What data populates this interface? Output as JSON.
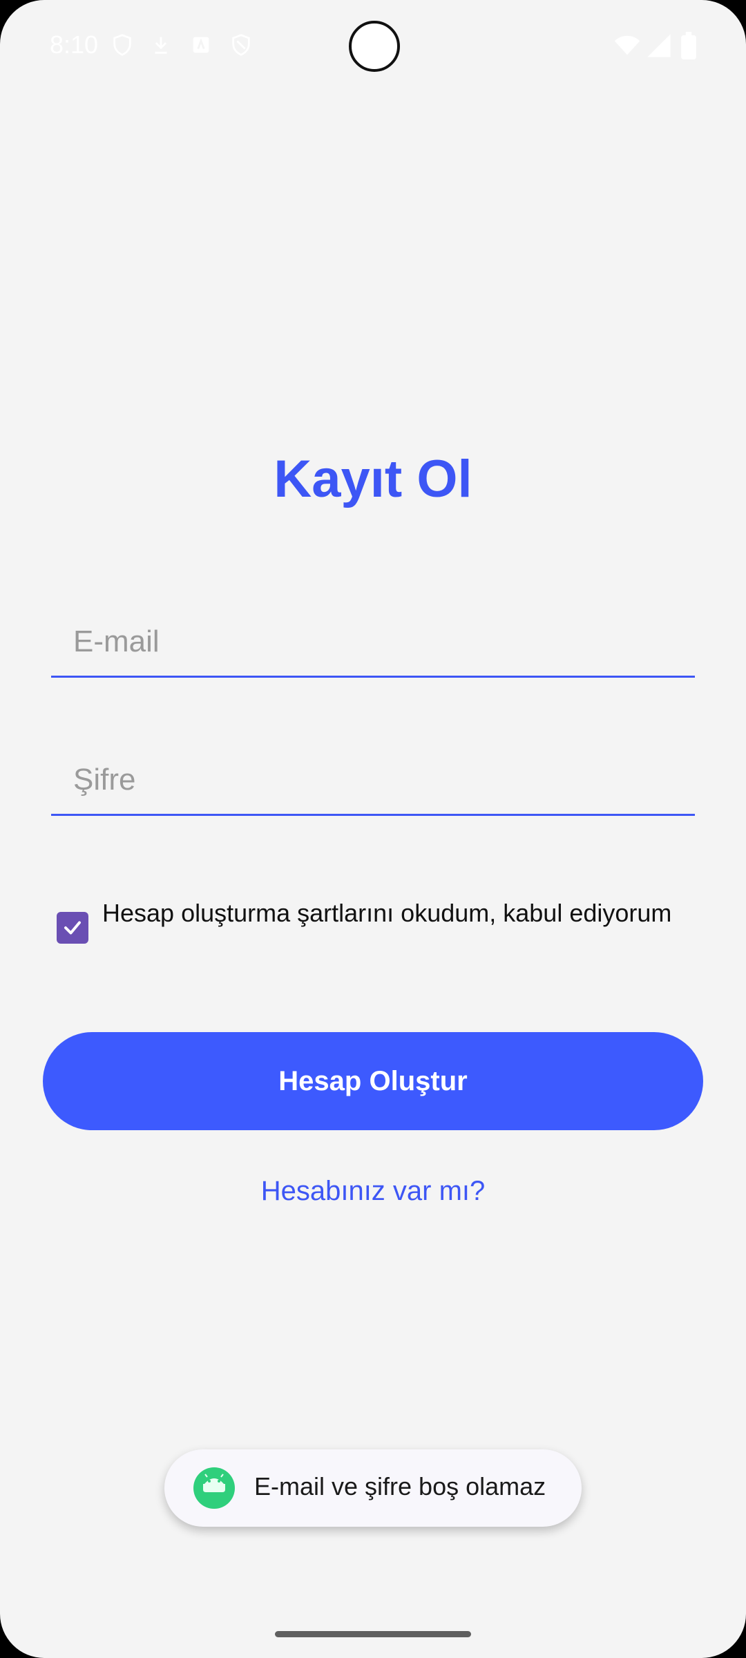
{
  "status_bar": {
    "time": "8:10"
  },
  "register": {
    "title": "Kayıt Ol",
    "email_placeholder": "E-mail",
    "password_placeholder": "Şifre",
    "terms_label": "Hesap oluşturma şartlarını okudum, kabul ediyorum",
    "terms_checked": true,
    "create_button_label": "Hesap Oluştur",
    "login_link_label": "Hesabınız var mı?"
  },
  "toast": {
    "message": "E-mail ve şifre boş olamaz",
    "icon": "android-icon"
  },
  "colors": {
    "accent": "#3d56f5",
    "button": "#3d5afe",
    "checkbox": "#6a4fb3",
    "background": "#f4f4f4",
    "toast_icon": "#2fcf7c"
  }
}
